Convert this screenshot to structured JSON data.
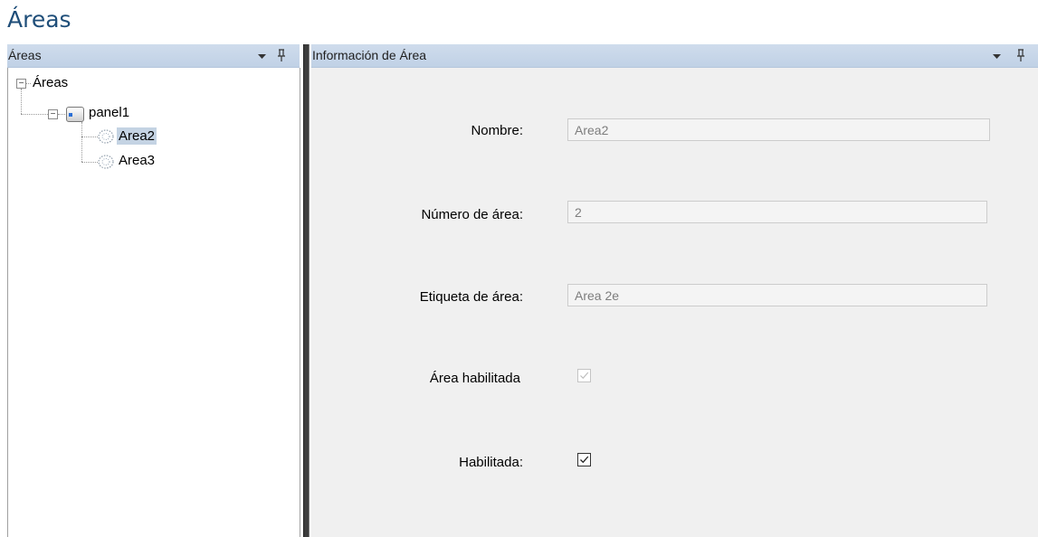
{
  "page": {
    "title": "Áreas"
  },
  "left_pane": {
    "header": "Áreas",
    "dropdown_icon": "chevron-down-icon",
    "pin_icon": "pin-icon",
    "tree": {
      "root_label": "Áreas",
      "panel_label": "panel1",
      "areas": [
        "Area2",
        "Area3"
      ],
      "selected": "Area2"
    }
  },
  "right_pane": {
    "header": "Información de Área",
    "dropdown_icon": "chevron-down-icon",
    "pin_icon": "pin-icon",
    "fields": {
      "nombre": {
        "label": "Nombre:",
        "value": "Area2"
      },
      "numero": {
        "label": "Número de área:",
        "value": "2"
      },
      "etiqueta": {
        "label": "Etiqueta de área:",
        "value": "Area 2e"
      },
      "area_habilitada": {
        "label": "Área habilitada",
        "checked": true,
        "enabled": false
      },
      "habilitada": {
        "label": "Habilitada:",
        "checked": true,
        "enabled": true
      }
    }
  },
  "colors": {
    "title": "#1f4e79",
    "header_bg": "#c8d7ea",
    "selection": "#c4d3e3",
    "form_bg": "#f0f0f0"
  }
}
